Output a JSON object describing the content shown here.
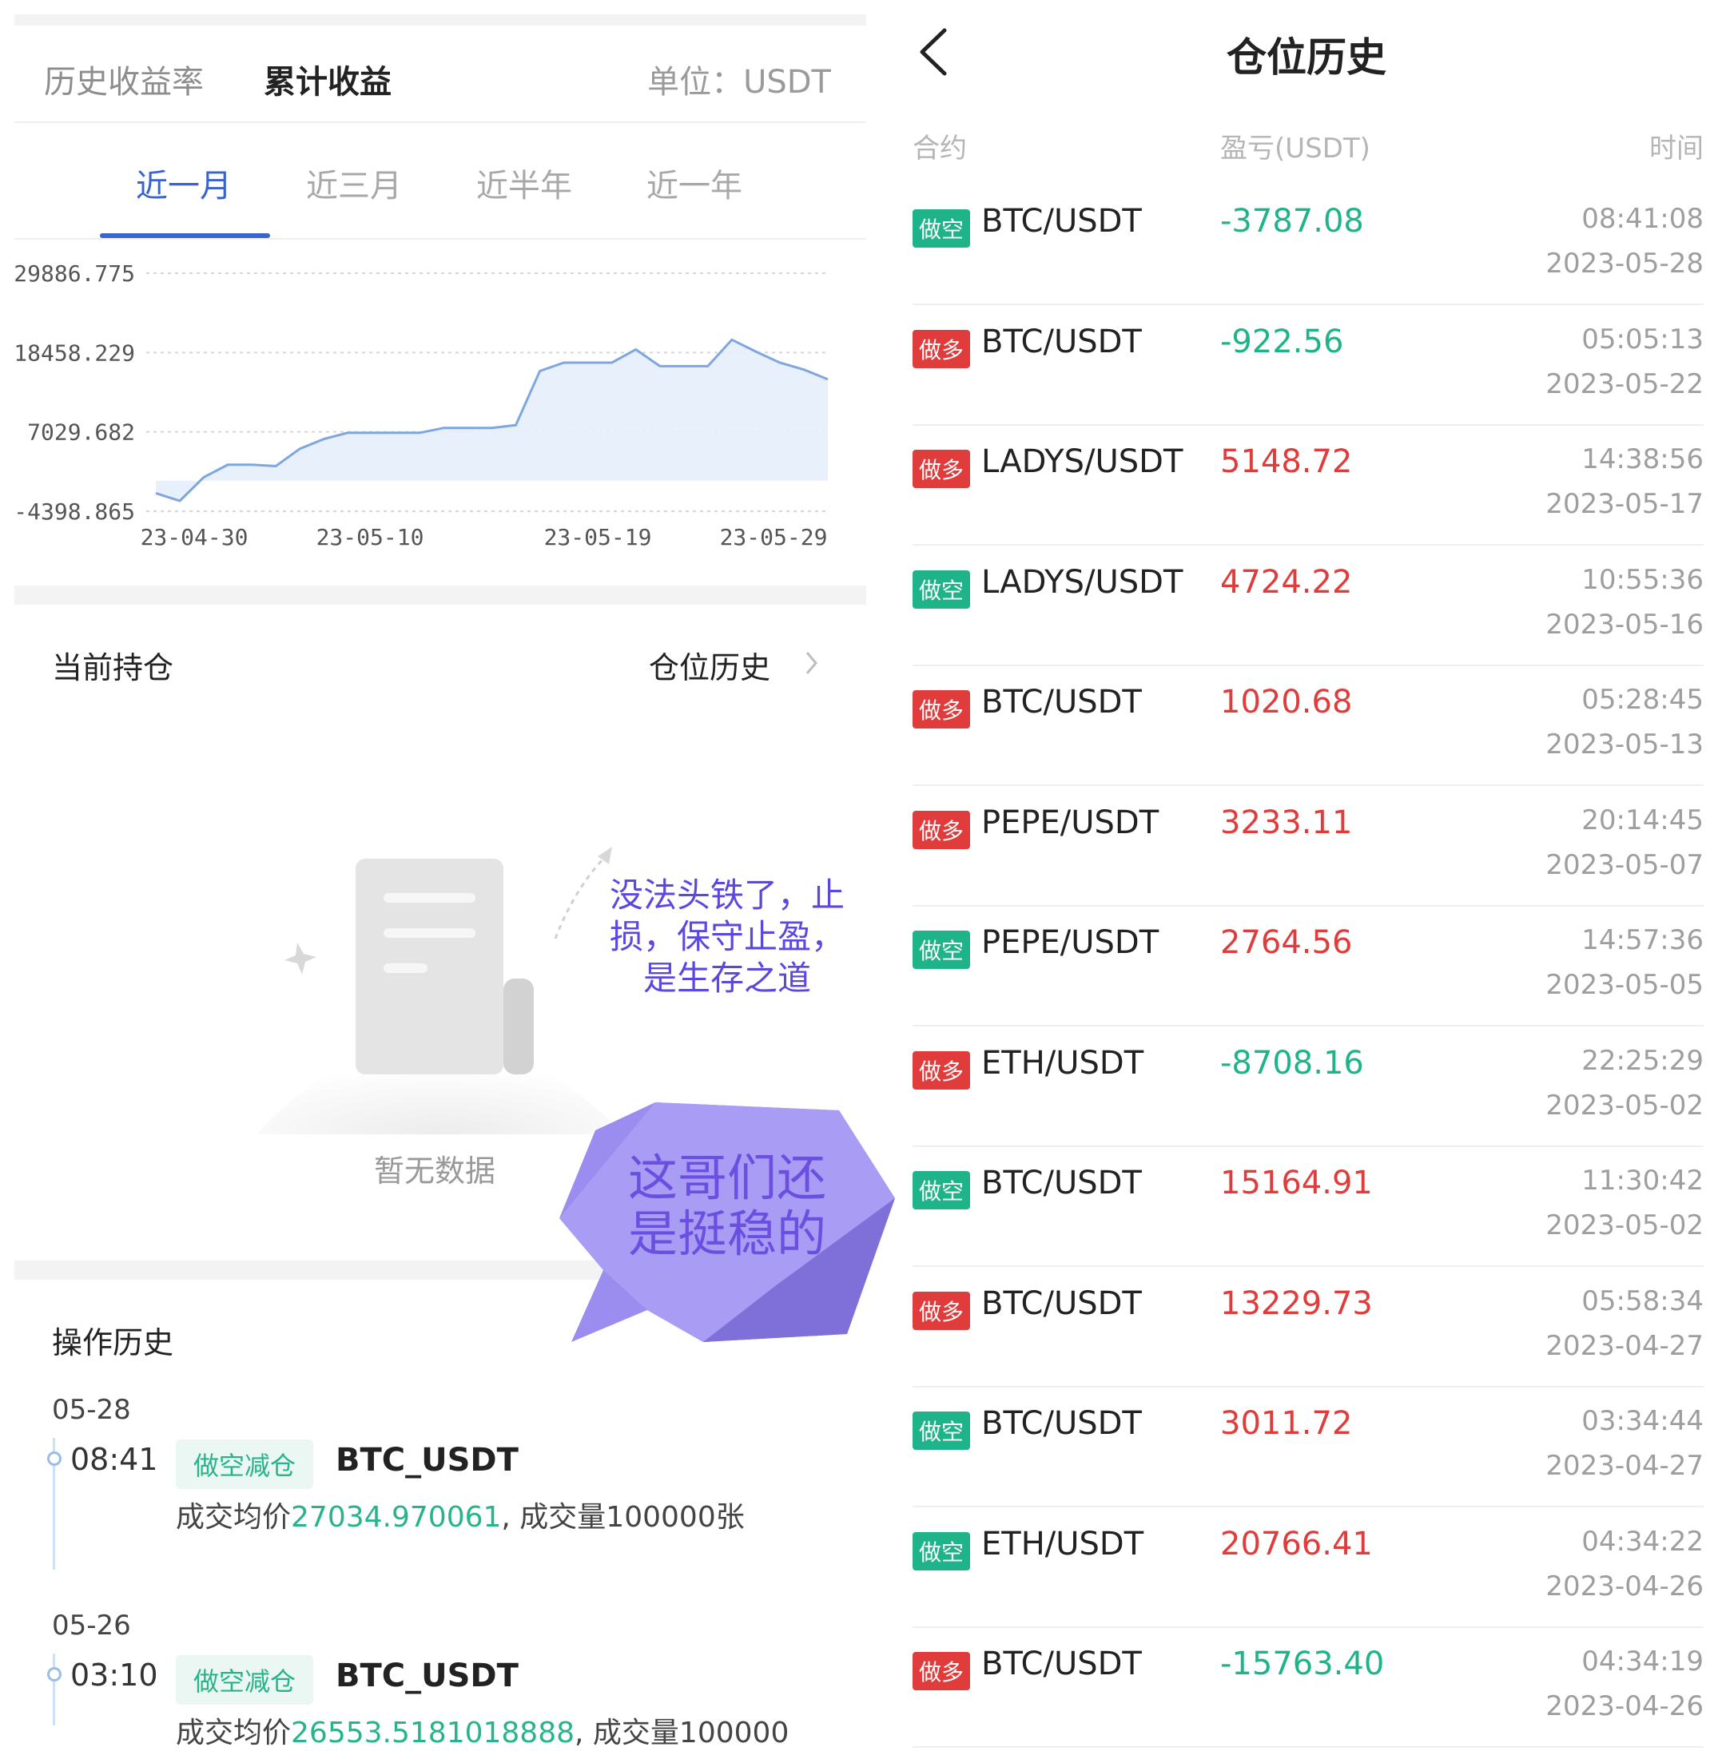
{
  "left": {
    "header": {
      "tab1": "历史收益率",
      "tab2": "累计收益",
      "unit": "单位：USDT"
    },
    "periods": [
      "近一月",
      "近三月",
      "近半年",
      "近一年"
    ],
    "current_position": {
      "title": "当前持仓",
      "history_link": "仓位历史",
      "empty_text": "暂无数据"
    },
    "operation_history": {
      "title": "操作历史",
      "items": [
        {
          "date": "05-28",
          "time": "08:41",
          "tag": "做空减仓",
          "symbol": "BTC_USDT",
          "detail_prefix": "成交均价",
          "price": "27034.970061",
          "detail_suffix": ", 成交量100000张"
        },
        {
          "date": "05-26",
          "time": "03:10",
          "tag": "做空减仓",
          "symbol": "BTC_USDT",
          "detail_prefix": "成交均价",
          "price": "26553.5181018888",
          "detail_suffix": ", 成交量100000"
        }
      ]
    }
  },
  "chart_data": {
    "type": "area",
    "title": "",
    "xlabel": "",
    "ylabel": "",
    "y_ticks": [
      "29886.775",
      "18458.229",
      "7029.682",
      "-4398.865"
    ],
    "x_ticks": [
      "23-04-30",
      "23-05-10",
      "23-05-19",
      "23-05-29"
    ],
    "ylim": [
      -4398.865,
      29886.775
    ],
    "grid": true,
    "series": [
      {
        "values": [
          -1800,
          -2900,
          500,
          2300,
          2300,
          2100,
          4600,
          6000,
          6900,
          6900,
          6900,
          6900,
          7600,
          7600,
          7600,
          8000,
          15800,
          17000,
          17000,
          17000,
          18900,
          16500,
          16500,
          16500,
          20300,
          18600,
          17000,
          16000,
          14600
        ]
      }
    ],
    "line_color": "#7ea6e0",
    "fill_color": "#e6f0fb"
  },
  "right": {
    "title": "仓位历史",
    "columns": {
      "contract": "合约",
      "pnl": "盈亏(USDT)",
      "time": "时间"
    },
    "rows": [
      {
        "side": "做空",
        "side_type": "short",
        "symbol": "BTC/USDT",
        "pnl": "-3787.08",
        "pnl_sign": "neg",
        "time": "08:41:08",
        "date": "2023-05-28"
      },
      {
        "side": "做多",
        "side_type": "long",
        "symbol": "BTC/USDT",
        "pnl": "-922.56",
        "pnl_sign": "neg",
        "time": "05:05:13",
        "date": "2023-05-22"
      },
      {
        "side": "做多",
        "side_type": "long",
        "symbol": "LADYS/USDT",
        "pnl": "5148.72",
        "pnl_sign": "pos",
        "time": "14:38:56",
        "date": "2023-05-17"
      },
      {
        "side": "做空",
        "side_type": "short",
        "symbol": "LADYS/USDT",
        "pnl": "4724.22",
        "pnl_sign": "pos",
        "time": "10:55:36",
        "date": "2023-05-16"
      },
      {
        "side": "做多",
        "side_type": "long",
        "symbol": "BTC/USDT",
        "pnl": "1020.68",
        "pnl_sign": "pos",
        "time": "05:28:45",
        "date": "2023-05-13"
      },
      {
        "side": "做多",
        "side_type": "long",
        "symbol": "PEPE/USDT",
        "pnl": "3233.11",
        "pnl_sign": "pos",
        "time": "20:14:45",
        "date": "2023-05-07"
      },
      {
        "side": "做空",
        "side_type": "short",
        "symbol": "PEPE/USDT",
        "pnl": "2764.56",
        "pnl_sign": "pos",
        "time": "14:57:36",
        "date": "2023-05-05"
      },
      {
        "side": "做多",
        "side_type": "long",
        "symbol": "ETH/USDT",
        "pnl": "-8708.16",
        "pnl_sign": "neg",
        "time": "22:25:29",
        "date": "2023-05-02"
      },
      {
        "side": "做空",
        "side_type": "short",
        "symbol": "BTC/USDT",
        "pnl": "15164.91",
        "pnl_sign": "pos",
        "time": "11:30:42",
        "date": "2023-05-02"
      },
      {
        "side": "做多",
        "side_type": "long",
        "symbol": "BTC/USDT",
        "pnl": "13229.73",
        "pnl_sign": "pos",
        "time": "05:58:34",
        "date": "2023-04-27"
      },
      {
        "side": "做空",
        "side_type": "short",
        "symbol": "BTC/USDT",
        "pnl": "3011.72",
        "pnl_sign": "pos",
        "time": "03:34:44",
        "date": "2023-04-27"
      },
      {
        "side": "做空",
        "side_type": "short",
        "symbol": "ETH/USDT",
        "pnl": "20766.41",
        "pnl_sign": "pos",
        "time": "04:34:22",
        "date": "2023-04-26"
      },
      {
        "side": "做多",
        "side_type": "long",
        "symbol": "BTC/USDT",
        "pnl": "-15763.40",
        "pnl_sign": "neg",
        "time": "04:34:19",
        "date": "2023-04-26"
      }
    ]
  },
  "annotations": {
    "note1": "没法头铁了，止损，保守止盈，是生存之道",
    "note2": "这哥们还是挺稳的"
  },
  "colors": {
    "accent": "#3a63d0",
    "short": "#1fb38a",
    "long": "#e03c3c",
    "bubble": "#9b8cf0"
  }
}
